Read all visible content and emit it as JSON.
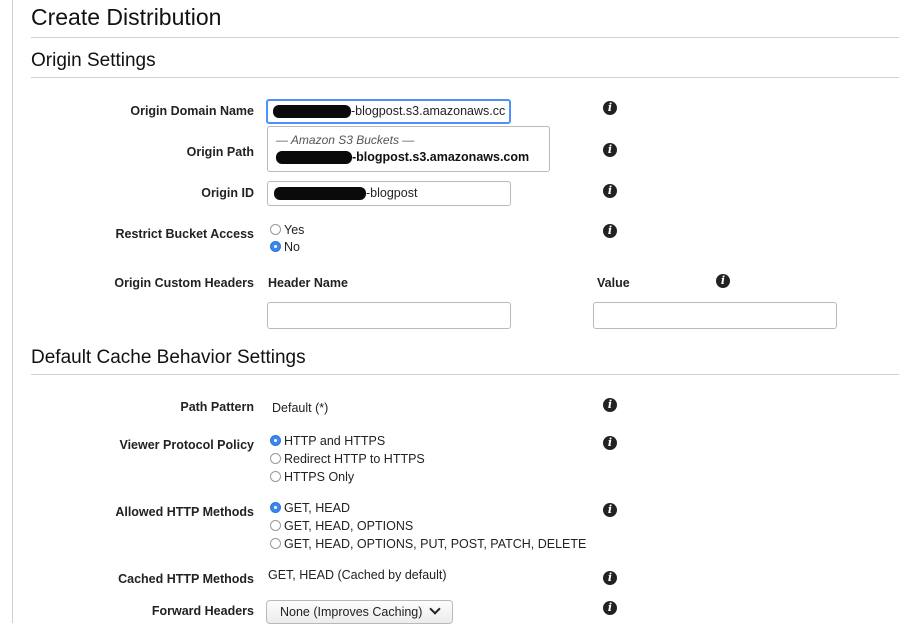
{
  "page": {
    "title": "Create Distribution"
  },
  "origin_settings": {
    "heading": "Origin Settings",
    "domain_name": {
      "label": "Origin Domain Name",
      "value_suffix": "-blogpost.s3.amazonaws.cc"
    },
    "dropdown": {
      "group_label": "— Amazon S3 Buckets —",
      "option_suffix": "-blogpost.s3.amazonaws.com"
    },
    "path": {
      "label": "Origin Path"
    },
    "origin_id": {
      "label": "Origin ID",
      "value_suffix": "-blogpost"
    },
    "restrict_bucket_access": {
      "label": "Restrict Bucket Access",
      "options": [
        "Yes",
        "No"
      ],
      "selected": "No"
    },
    "custom_headers": {
      "label": "Origin Custom Headers",
      "col_header_name": "Header Name",
      "col_value": "Value"
    }
  },
  "cache_behavior": {
    "heading": "Default Cache Behavior Settings",
    "path_pattern": {
      "label": "Path Pattern",
      "value": "Default (*)"
    },
    "viewer_protocol_policy": {
      "label": "Viewer Protocol Policy",
      "options": [
        "HTTP and HTTPS",
        "Redirect HTTP to HTTPS",
        "HTTPS Only"
      ],
      "selected": "HTTP and HTTPS"
    },
    "allowed_http_methods": {
      "label": "Allowed HTTP Methods",
      "options": [
        "GET, HEAD",
        "GET, HEAD, OPTIONS",
        "GET, HEAD, OPTIONS, PUT, POST, PATCH, DELETE"
      ],
      "selected": "GET, HEAD"
    },
    "cached_http_methods": {
      "label": "Cached HTTP Methods",
      "value": "GET, HEAD (Cached by default)"
    },
    "forward_headers": {
      "label": "Forward Headers",
      "value": "None (Improves Caching)"
    }
  },
  "icons": {
    "info": "info-icon",
    "chevron": "chevron-down-icon"
  },
  "colors": {
    "accent": "#3b86f0",
    "focus_border": "#4d90fe",
    "rule": "#cfcfcf"
  }
}
